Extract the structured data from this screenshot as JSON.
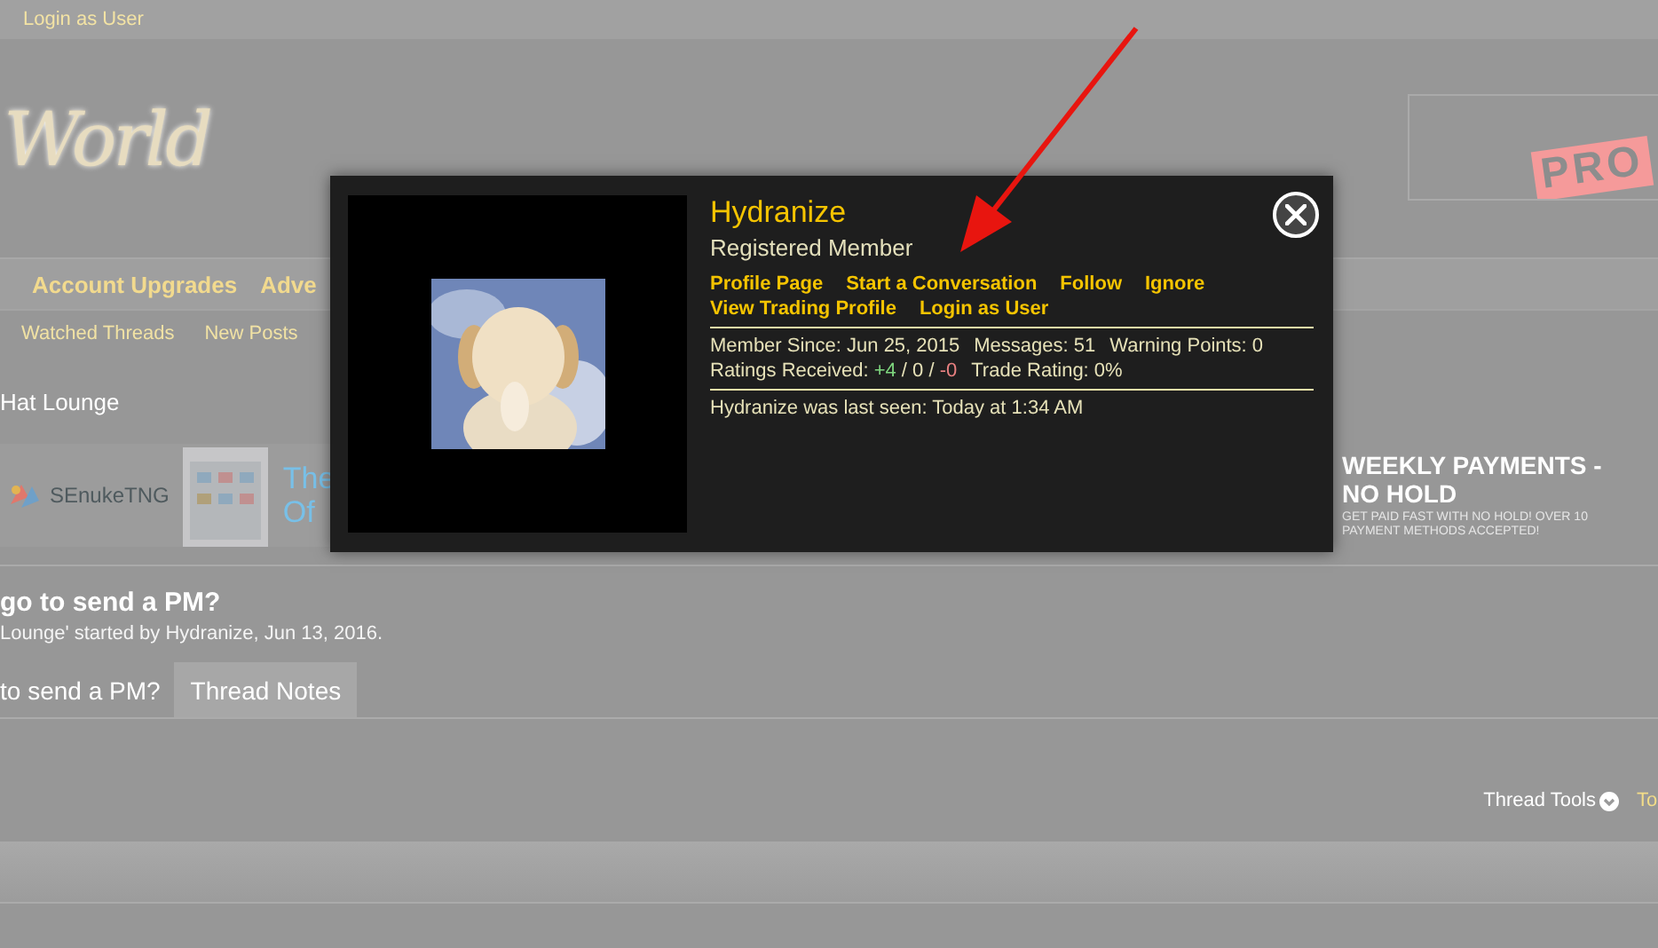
{
  "top_bar": {
    "link": "Login as User"
  },
  "header": {
    "logo": "World",
    "ad_text": "PRO"
  },
  "nav": {
    "tabs": [
      "Account Upgrades",
      "Adve"
    ],
    "sub_links": [
      "Watched Threads",
      "New Posts"
    ]
  },
  "breadcrumb": "Hat Lounge",
  "banners": {
    "left": {
      "brand": "SEnukeTNG",
      "lines": [
        "The",
        "Of"
      ]
    },
    "right": {
      "headline": [
        "WEEKLY PAYMENTS -",
        "NO HOLD"
      ],
      "tagline": "GET PAID FAST WITH NO HOLD! OVER 10 PAYMENT METHODS ACCEPTED!"
    }
  },
  "thread": {
    "title": "go to send a PM?",
    "byline": "Lounge' started by Hydranize, Jun 13, 2016.",
    "tabs": [
      {
        "label": "to send a PM?",
        "selected": true
      },
      {
        "label": "Thread Notes",
        "selected": false
      }
    ],
    "tools": [
      "Thread Tools",
      "To"
    ]
  },
  "popup": {
    "name": "Hydranize",
    "title": "Registered Member",
    "link_rows": [
      [
        "Profile Page",
        "Start a Conversation",
        "Follow",
        "Ignore"
      ],
      [
        "View Trading Profile",
        "Login as User"
      ]
    ],
    "stats": [
      "Member Since: Jun 25, 2015",
      "Messages: 51",
      "Warning Points: 0"
    ],
    "ratings": {
      "label": "Ratings Received:",
      "positive": "+4",
      "neutral": "0",
      "negative": "-0",
      "separator": "/"
    },
    "trade_rating": "Trade Rating: 0%",
    "last_seen": "Hydranize was last seen: Today at 1:34 AM"
  }
}
